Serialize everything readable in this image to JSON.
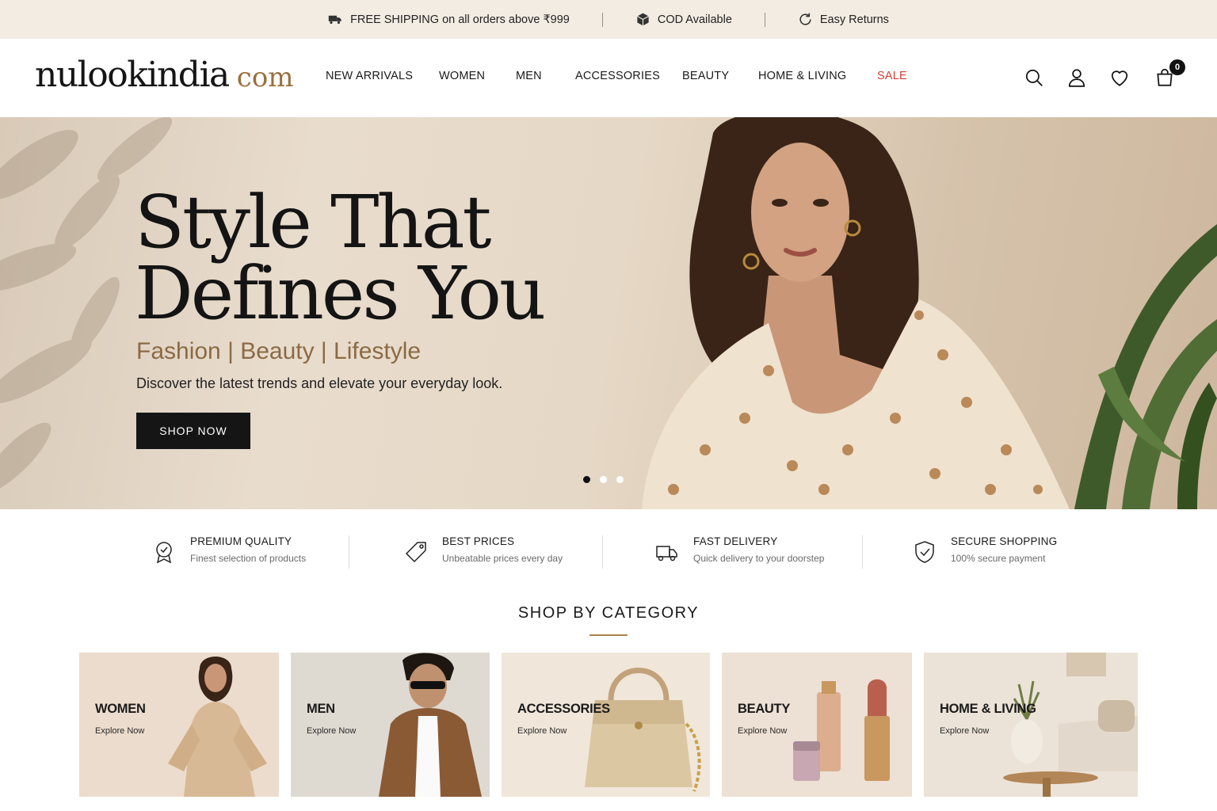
{
  "topbar": {
    "items": [
      {
        "icon": "truck-icon",
        "text": "FREE SHIPPING on all orders above ₹999"
      },
      {
        "icon": "box-icon",
        "text": "COD Available"
      },
      {
        "icon": "return-icon",
        "text": "Easy Returns"
      }
    ]
  },
  "header": {
    "logo_main": "nulookindia",
    "logo_tld": "com",
    "nav": [
      "NEW ARRIVALS",
      "WOMEN",
      "MEN",
      "ACCESSORIES",
      "BEAUTY",
      "HOME & LIVING",
      "SALE"
    ],
    "icons": [
      "search-icon",
      "user-icon",
      "heart-icon",
      "bag-icon"
    ],
    "cart_count": "0"
  },
  "hero": {
    "title": "Style That\nDefines You",
    "subtitle": "Fashion | Beauty | Lifestyle",
    "description": "Discover the latest trends and elevate your everyday look.",
    "button": "SHOP NOW",
    "slides": 3,
    "active_slide": 1
  },
  "features": [
    {
      "icon": "badge-check-icon",
      "title": "PREMIUM QUALITY",
      "desc": "Finest selection of products"
    },
    {
      "icon": "price-tag-icon",
      "title": "BEST PRICES",
      "desc": "Unbeatable prices every day"
    },
    {
      "icon": "delivery-truck-icon",
      "title": "FAST DELIVERY",
      "desc": "Quick delivery to your doorstep"
    },
    {
      "icon": "shield-check-icon",
      "title": "SECURE SHOPPING",
      "desc": "100% secure payment"
    }
  ],
  "categories": {
    "heading": "SHOP BY CATEGORY",
    "items": [
      {
        "name": "WOMEN",
        "cta": "Explore Now"
      },
      {
        "name": "MEN",
        "cta": "Explore Now"
      },
      {
        "name": "ACCESSORIES",
        "cta": "Explore Now"
      },
      {
        "name": "BEAUTY",
        "cta": "Explore Now"
      },
      {
        "name": "HOME & LIVING",
        "cta": "Explore Now"
      }
    ]
  },
  "colors": {
    "topbar_bg": "#f3ece3",
    "accent_gold": "#9b6f3f",
    "sale_red": "#d1403a",
    "button_dark": "#151515"
  }
}
